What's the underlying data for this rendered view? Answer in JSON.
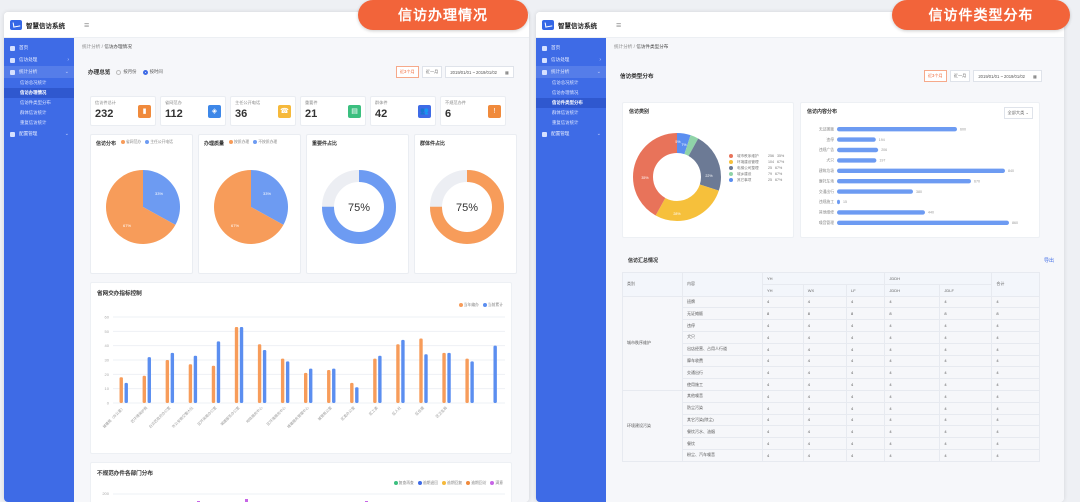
{
  "left": {
    "app_title": "智慧信访系统",
    "callout": "信访办理情况",
    "breadcrumb": {
      "parent": "统计分析",
      "sep": "/",
      "current": "信访办理情况"
    },
    "sidebar": {
      "items": [
        {
          "label": "首页",
          "chevron": ""
        },
        {
          "label": "信访处理",
          "chevron": "›"
        },
        {
          "label": "统计分析",
          "chevron": "⌄"
        }
      ],
      "subs": [
        "信访总况统计",
        "信访办理情况",
        "信访件类型分布",
        "群体信访统计",
        "重复信访统计"
      ],
      "active_sub": 1,
      "extra": {
        "label": "配置管理",
        "chevron": "⌄"
      }
    },
    "overview": {
      "title": "办理总览",
      "radio1": "按月份",
      "radio2": "按时间",
      "btn1": "近3个月",
      "btn2": "近一月",
      "date": "2019/01/01 ~ 2019/01/02"
    },
    "stats": [
      {
        "label": "信访件总计",
        "value": "232",
        "color": "#f08a3c",
        "icon": "chart-icon"
      },
      {
        "label": "省网范办",
        "value": "112",
        "color": "#3d87e8",
        "icon": "layers-icon"
      },
      {
        "label": "主任公开电话",
        "value": "36",
        "color": "#f6b93b",
        "icon": "phone-icon"
      },
      {
        "label": "重要件",
        "value": "21",
        "color": "#3bbf7f",
        "icon": "doc-icon"
      },
      {
        "label": "群体件",
        "value": "42",
        "color": "#3e6be6",
        "icon": "users-icon"
      },
      {
        "label": "不规范办件",
        "value": "6",
        "color": "#f08a3c",
        "icon": "warning-icon"
      }
    ],
    "minis": [
      {
        "title": "信访分布",
        "leg1": "省网范办",
        "leg2": "主任公开电话",
        "pie": [
          67,
          33
        ],
        "label_a": "67%",
        "label_b": "33%"
      },
      {
        "title": "办理质量",
        "leg1": "按质办理",
        "leg2": "不按质办理",
        "pie": [
          67,
          33
        ],
        "label_a": "67%",
        "label_b": "33%"
      },
      {
        "title": "重要件占比",
        "donut": 75,
        "color": "#6d9bf2",
        "label": "75%"
      },
      {
        "title": "群体件占比",
        "donut": 75,
        "color": "#f79c5a",
        "label": "75%"
      }
    ],
    "bar_title": "省网交办指标控制",
    "bar_legend": [
      "当年编办",
      "当前累计"
    ],
    "bar_colors": [
      "#f79c5a",
      "#5b8ef0"
    ],
    "chart_data": {
      "type": "bar",
      "categories": [
        "城建局（办公室）",
        "区环境保护局",
        "白云区政府办公室",
        "市公安局交警大队",
        "区环保局办公室",
        "城建服务办公室",
        "地铁服务中心",
        "区环境服务中心",
        "城建服务管理中心",
        "城管局公室",
        "区委办公室",
        "区工委",
        "区人社",
        "区住建",
        "区卫生局"
      ],
      "series": [
        {
          "name": "当年编办",
          "values": [
            18,
            19,
            30,
            27,
            26,
            53,
            41,
            31,
            21,
            23,
            14,
            31,
            41,
            45,
            35,
            31
          ]
        },
        {
          "name": "当前累计",
          "values": [
            14,
            32,
            35,
            33,
            43,
            53,
            37,
            29,
            24,
            24,
            11,
            33,
            44,
            34,
            35,
            29,
            40
          ]
        }
      ],
      "ylim": [
        0,
        60
      ],
      "yticks": [
        "0",
        "10",
        "20",
        "30",
        "40",
        "50",
        "60"
      ]
    },
    "stack_title": "不规范办件各部门分布",
    "stack_legend": [
      "复查再查",
      "逾期退回",
      "逾期回复",
      "逾期回访",
      "满意"
    ],
    "stack_colors": [
      "#3bbf7f",
      "#3e6be6",
      "#f6b93b",
      "#f08a3c",
      "#c765e6"
    ],
    "stack_yticks": [
      "200",
      "150"
    ]
  },
  "right": {
    "app_title": "智慧信访系统",
    "callout": "信访件类型分布",
    "breadcrumb": {
      "parent": "统计分析",
      "sep": "/",
      "current": "信访件类型分布"
    },
    "sidebar": {
      "items": [
        {
          "label": "首页",
          "chevron": ""
        },
        {
          "label": "信访处理",
          "chevron": "›"
        },
        {
          "label": "统计分析",
          "chevron": "⌄"
        }
      ],
      "subs": [
        "信访总况统计",
        "信访办理情况",
        "信访件类型分布",
        "群体信访统计",
        "重复信访统计"
      ],
      "active_sub": 2,
      "extra": {
        "label": "配置管理",
        "chevron": "⌄"
      }
    },
    "type_panel": {
      "title": "信访类型分布",
      "btn1": "近3个月",
      "btn2": "近一月",
      "date": "2019/01/01 ~ 2019/01/02"
    },
    "category": {
      "title": "信访类别",
      "slices": [
        {
          "name": "城市秩序维护",
          "value": "256",
          "pct": "35%",
          "color": "#e8735a"
        },
        {
          "name": "环境建设管理",
          "value": "104",
          "pct": "67%",
          "color": "#f6c03b"
        },
        {
          "name": "电梯公司整理",
          "value": "25",
          "pct": "67%",
          "color": "#6c7a95"
        },
        {
          "name": "城乡建设",
          "value": "79",
          "pct": "67%",
          "color": "#8fd3a8"
        },
        {
          "name": "其它事项",
          "value": "25",
          "pct": "67%",
          "color": "#5b8ef0"
        }
      ],
      "ring_labels": [
        "35%",
        "28%",
        "22%",
        "7%",
        "5%"
      ]
    },
    "content": {
      "title": "信访内容分布",
      "select": "全部大类",
      "rows": [
        {
          "label": "无证摊贩",
          "value": 600
        },
        {
          "label": "违停",
          "value": 194
        },
        {
          "label": "违规广告",
          "value": 206
        },
        {
          "label": "犬只",
          "value": 197
        },
        {
          "label": "建筑垃圾",
          "value": 840
        },
        {
          "label": "摩托车场",
          "value": 670
        },
        {
          "label": "交通出行",
          "value": 380
        },
        {
          "label": "违规施工",
          "value": 15
        },
        {
          "label": "其他维修",
          "value": 440
        },
        {
          "label": "噪音管理",
          "value": 860
        }
      ],
      "max": 900
    },
    "summary": {
      "title": "信访汇总情况",
      "export": "导出",
      "head_top": [
        "类别",
        "内容",
        "YH",
        "JDDH",
        "合计"
      ],
      "head_sub": [
        "YH",
        "WX",
        "LF",
        "JDDH",
        "JDLF"
      ],
      "group1": "城市秩序维护",
      "group2": "环境建设污染",
      "rows": [
        {
          "c": "班牌",
          "v": [
            "4",
            "4",
            "4",
            "4",
            "4",
            "4"
          ]
        },
        {
          "c": "无证摊贩",
          "v": [
            "8",
            "8",
            "8",
            "8",
            "8",
            "8"
          ]
        },
        {
          "c": "违停",
          "v": [
            "4",
            "4",
            "4",
            "4",
            "4",
            "4"
          ]
        },
        {
          "c": "犬只",
          "v": [
            "4",
            "4",
            "4",
            "4",
            "4",
            "4"
          ]
        },
        {
          "c": "出店经营、占用人行道",
          "v": [
            "4",
            "4",
            "4",
            "4",
            "4",
            "4"
          ]
        },
        {
          "c": "摩车收费",
          "v": [
            "4",
            "4",
            "4",
            "4",
            "4",
            "4"
          ]
        },
        {
          "c": "交通出行",
          "v": [
            "4",
            "4",
            "4",
            "4",
            "4",
            "4"
          ]
        },
        {
          "c": "使用施工",
          "v": [
            "4",
            "4",
            "4",
            "4",
            "4",
            "4"
          ]
        },
        {
          "c": "其他噪音",
          "v": [
            "4",
            "4",
            "4",
            "4",
            "4",
            "4"
          ]
        },
        {
          "c": "防尘污染",
          "v": [
            "4",
            "4",
            "4",
            "4",
            "4",
            "4"
          ]
        },
        {
          "c": "其它污染(除尘)",
          "v": [
            "4",
            "4",
            "4",
            "4",
            "4",
            "4"
          ]
        },
        {
          "c": "餐饮污水、油烟",
          "v": [
            "4",
            "4",
            "4",
            "4",
            "4",
            "4"
          ]
        },
        {
          "c": "餐饮",
          "v": [
            "4",
            "4",
            "4",
            "4",
            "4",
            "4"
          ]
        },
        {
          "c": "粉尘、汽车噪音",
          "v": [
            "4",
            "4",
            "4",
            "4",
            "4",
            "4"
          ]
        }
      ]
    }
  }
}
